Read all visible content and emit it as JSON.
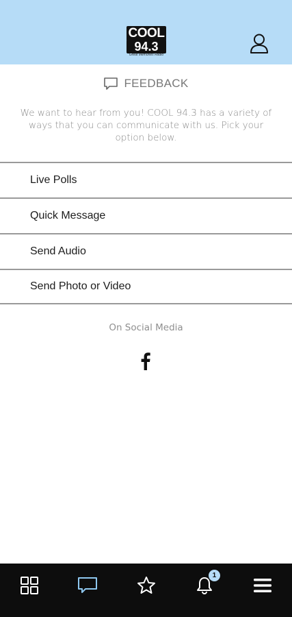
{
  "header": {
    "logo_line1": "COOL",
    "logo_line2": "94.3",
    "logo_tagline": "Great Memories Radio",
    "profile_icon": "user-icon"
  },
  "feedback": {
    "title": "FEEDBACK",
    "intro": "We want to hear from you! COOL 94.3 has a variety of ways that you can communicate with us. Pick your option below."
  },
  "menu": {
    "items": [
      {
        "label": "Live Polls"
      },
      {
        "label": "Quick Message"
      },
      {
        "label": "Send Audio"
      },
      {
        "label": "Send Photo or Video"
      }
    ]
  },
  "social": {
    "label": "On Social Media",
    "facebook_icon": "facebook-icon"
  },
  "bottom_nav": {
    "items": [
      {
        "icon": "grid-icon",
        "active": false
      },
      {
        "icon": "chat-icon",
        "active": true
      },
      {
        "icon": "star-icon",
        "active": false
      },
      {
        "icon": "bell-icon",
        "active": false,
        "badge": "1"
      },
      {
        "icon": "menu-icon",
        "active": false
      }
    ]
  },
  "colors": {
    "header_bg": "#b6dcf7",
    "nav_bg": "#0d0d0d",
    "nav_active": "#8fc8f0",
    "nav_inactive": "#ffffff"
  }
}
